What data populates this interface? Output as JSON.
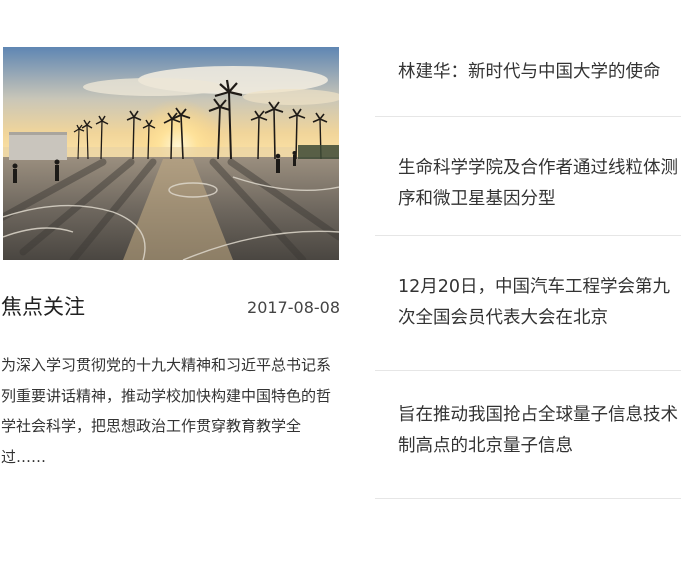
{
  "feature": {
    "title": "焦点关注",
    "date": "2017-08-08",
    "summary": "为深入学习贯彻党的十九大精神和习近平总书记系列重要讲话精神，推动学校加快构建中国特色的哲学社会科学，把思想政治工作贯穿教育教学全过……",
    "image_subject": "sunset basketball court with palm trees"
  },
  "news": [
    {
      "text": "林建华：新时代与中国大学的使命"
    },
    {
      "text": "生命科学学院及合作者通过线粒体测序和微卫星基因分型"
    },
    {
      "text": "12月20日，中国汽车工程学会第九次全国会员代表大会在北京"
    },
    {
      "text": "旨在推动我国抢占全球量子信息技术制高点的北京量子信息"
    }
  ],
  "colors": {
    "text": "#333333",
    "divider": "#e6e6e6",
    "sky_top": "#6a8fb8",
    "sun": "#ffd98a",
    "court": "#8f8579"
  }
}
